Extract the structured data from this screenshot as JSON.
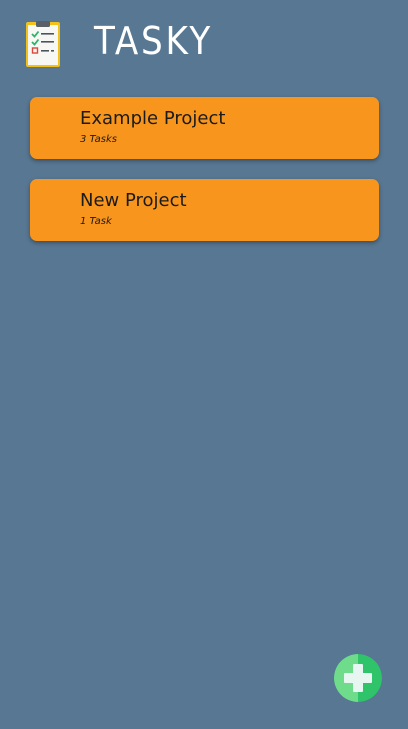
{
  "app": {
    "title": "TASKY"
  },
  "projects": [
    {
      "name": "Example Project",
      "count": "3 Tasks"
    },
    {
      "name": "New Project",
      "count": "1 Task"
    }
  ],
  "icons": {
    "logo": "clipboard-checklist-icon",
    "add": "plus-icon"
  },
  "colors": {
    "background": "#587793",
    "card": "#f8951d",
    "add_button": "#2fc36a"
  }
}
